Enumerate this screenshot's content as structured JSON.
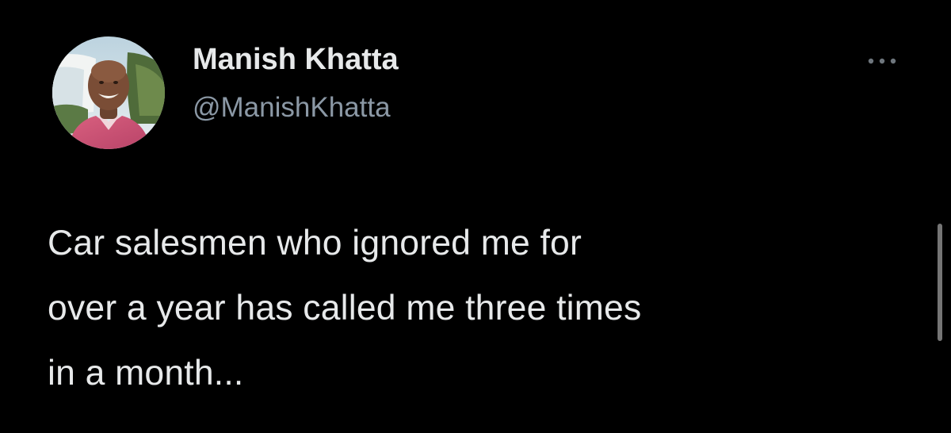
{
  "tweet": {
    "author": {
      "display_name": "Manish Khatta",
      "handle": "@ManishKhatta"
    },
    "text": "Car salesmen who ignored me for\nover a year has called me three times\nin a month...",
    "icons": {
      "avatar": "profile-photo",
      "more": "more-horizontal-icon"
    }
  },
  "colors": {
    "background": "#000000",
    "primary_text": "#e7e9ea",
    "secondary_text": "#8b98a5"
  }
}
